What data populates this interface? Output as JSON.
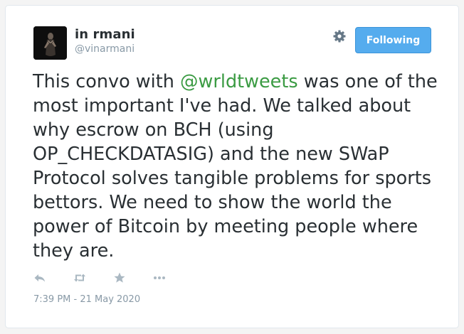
{
  "user": {
    "display_name": "in rmani",
    "handle": "@vinarmani",
    "avatar_icon": "profile-photo-avatar"
  },
  "header": {
    "settings_icon": "gear-icon",
    "follow_button_label": "Following"
  },
  "tweet": {
    "text_before_mention": "This convo with ",
    "mention": "@wrldtweets",
    "text_after_mention": " was one of the most important I've had. We talked about why escrow on BCH (using OP_CHECKDATASIG) and the new SWaP Protocol solves tangible problems for sports bettors. We need to show the world the power of Bitcoin by meeting people where they are."
  },
  "actions": [
    {
      "name": "reply-icon"
    },
    {
      "name": "retweet-icon"
    },
    {
      "name": "like-star-icon"
    },
    {
      "name": "more-icon"
    }
  ],
  "timestamp": "7:39 PM - 21 May 2020",
  "colors": {
    "follow_button": "#55acee",
    "mention": "#3b9b43",
    "text": "#292f33",
    "muted": "#8899a6",
    "action_icons": "#aab8c2"
  }
}
